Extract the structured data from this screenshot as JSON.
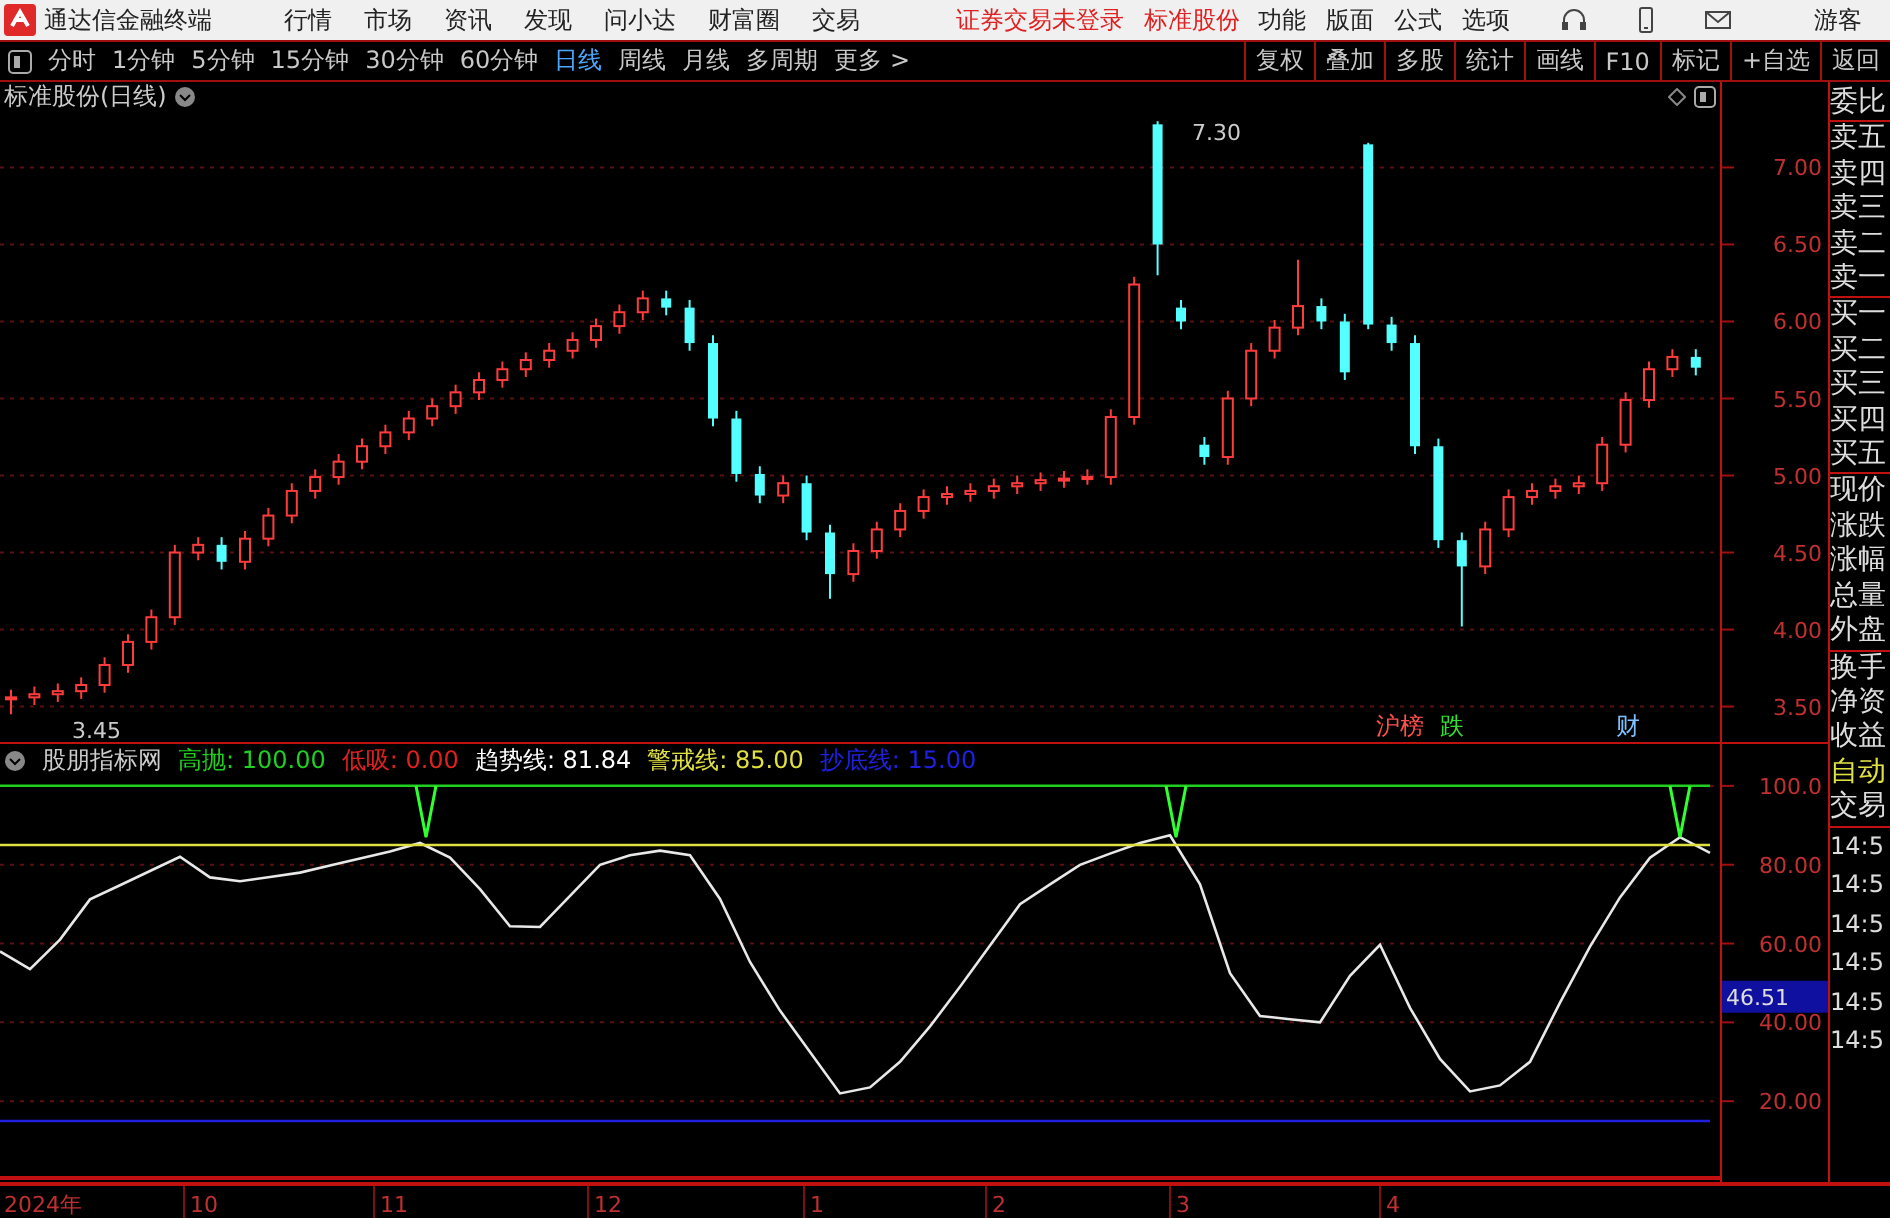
{
  "app": {
    "title": "通达信金融终端",
    "menus": [
      "行情",
      "市场",
      "资讯",
      "发现",
      "问小达",
      "财富圈",
      "交易"
    ],
    "status": [
      "证券交易未登录",
      "标准股份"
    ],
    "tools": [
      "功能",
      "版面",
      "公式",
      "选项"
    ],
    "user": "游客"
  },
  "toolbar": {
    "periods": [
      {
        "label": "分时",
        "selected": false
      },
      {
        "label": "1分钟",
        "selected": false
      },
      {
        "label": "5分钟",
        "selected": false
      },
      {
        "label": "15分钟",
        "selected": false
      },
      {
        "label": "30分钟",
        "selected": false
      },
      {
        "label": "60分钟",
        "selected": false
      },
      {
        "label": "日线",
        "selected": true
      },
      {
        "label": "周线",
        "selected": false
      },
      {
        "label": "月线",
        "selected": false
      },
      {
        "label": "多周期",
        "selected": false
      },
      {
        "label": "更多 >",
        "selected": false
      }
    ],
    "actions": [
      "复权",
      "叠加",
      "多股",
      "统计",
      "画线",
      "F10",
      "标记",
      "+自选",
      "返回"
    ]
  },
  "chart": {
    "title": "标准股份(日线)",
    "high_label": "7.30",
    "low_label": "3.45",
    "events": [
      {
        "label": "沪榜",
        "color": "#ff5050"
      },
      {
        "label": "跌",
        "color": "#30e030"
      },
      {
        "label": "财",
        "color": "#80c0ff"
      }
    ],
    "chart_data": {
      "type": "candlestick",
      "grid": true,
      "ylim": [
        3.27,
        7.36
      ],
      "yticks": [
        {
          "value": 7,
          "label": "7.00"
        },
        {
          "value": 6.5,
          "label": "6.50"
        },
        {
          "value": 6,
          "label": "6.00"
        },
        {
          "value": 5.5,
          "label": "5.50"
        },
        {
          "value": 5,
          "label": "5.00"
        },
        {
          "value": 4.5,
          "label": "4.50"
        },
        {
          "value": 4,
          "label": "4.00"
        },
        {
          "value": 3.5,
          "label": "3.50"
        }
      ],
      "ohlc": [
        [
          3.55,
          3.61,
          3.45,
          3.56
        ],
        [
          3.56,
          3.63,
          3.51,
          3.58
        ],
        [
          3.58,
          3.65,
          3.53,
          3.6
        ],
        [
          3.6,
          3.69,
          3.55,
          3.64
        ],
        [
          3.64,
          3.82,
          3.59,
          3.77
        ],
        [
          3.77,
          3.97,
          3.72,
          3.92
        ],
        [
          3.92,
          4.13,
          3.87,
          4.08
        ],
        [
          4.08,
          4.55,
          4.03,
          4.5
        ],
        [
          4.5,
          4.6,
          4.45,
          4.55
        ],
        [
          4.55,
          4.6,
          4.39,
          4.44
        ],
        [
          4.44,
          4.64,
          4.39,
          4.59
        ],
        [
          4.59,
          4.79,
          4.54,
          4.74
        ],
        [
          4.74,
          4.95,
          4.69,
          4.9
        ],
        [
          4.9,
          5.04,
          4.85,
          4.99
        ],
        [
          4.99,
          5.14,
          4.94,
          5.09
        ],
        [
          5.09,
          5.24,
          5.04,
          5.19
        ],
        [
          5.19,
          5.33,
          5.14,
          5.28
        ],
        [
          5.28,
          5.42,
          5.23,
          5.37
        ],
        [
          5.37,
          5.5,
          5.32,
          5.45
        ],
        [
          5.45,
          5.59,
          5.4,
          5.54
        ],
        [
          5.54,
          5.67,
          5.49,
          5.62
        ],
        [
          5.62,
          5.74,
          5.57,
          5.69
        ],
        [
          5.69,
          5.8,
          5.64,
          5.75
        ],
        [
          5.75,
          5.86,
          5.7,
          5.81
        ],
        [
          5.81,
          5.93,
          5.76,
          5.88
        ],
        [
          5.88,
          6.02,
          5.83,
          5.97
        ],
        [
          5.97,
          6.11,
          5.92,
          6.06
        ],
        [
          6.06,
          6.2,
          6.01,
          6.15
        ],
        [
          6.15,
          6.2,
          6.04,
          6.09
        ],
        [
          6.09,
          6.14,
          5.81,
          5.86
        ],
        [
          5.86,
          5.91,
          5.32,
          5.37
        ],
        [
          5.37,
          5.42,
          4.96,
          5.01
        ],
        [
          5.01,
          5.06,
          4.82,
          4.87
        ],
        [
          4.87,
          5.0,
          4.82,
          4.95
        ],
        [
          4.95,
          5.0,
          4.58,
          4.63
        ],
        [
          4.63,
          4.68,
          4.2,
          4.36
        ],
        [
          4.36,
          4.56,
          4.31,
          4.51
        ],
        [
          4.51,
          4.7,
          4.46,
          4.65
        ],
        [
          4.65,
          4.82,
          4.6,
          4.77
        ],
        [
          4.77,
          4.91,
          4.72,
          4.86
        ],
        [
          4.86,
          4.93,
          4.81,
          4.88
        ],
        [
          4.88,
          4.95,
          4.83,
          4.9
        ],
        [
          4.9,
          4.98,
          4.85,
          4.93
        ],
        [
          4.93,
          5.0,
          4.88,
          4.95
        ],
        [
          4.95,
          5.02,
          4.9,
          4.97
        ],
        [
          4.97,
          5.03,
          4.92,
          4.98
        ],
        [
          4.98,
          5.04,
          4.94,
          4.99
        ],
        [
          4.99,
          5.43,
          4.94,
          5.38
        ],
        [
          5.38,
          6.29,
          5.33,
          6.24
        ],
        [
          7.28,
          7.3,
          6.3,
          6.5
        ],
        [
          6.09,
          6.14,
          5.95,
          6.0
        ],
        [
          5.2,
          5.25,
          5.07,
          5.12
        ],
        [
          5.12,
          5.55,
          5.07,
          5.5
        ],
        [
          5.5,
          5.86,
          5.45,
          5.81
        ],
        [
          5.81,
          6.01,
          5.76,
          5.96
        ],
        [
          5.96,
          6.4,
          5.91,
          6.1
        ],
        [
          6.1,
          6.15,
          5.95,
          6.0
        ],
        [
          6.0,
          6.05,
          5.62,
          5.67
        ],
        [
          7.15,
          7.16,
          5.95,
          5.98
        ],
        [
          5.98,
          6.03,
          5.81,
          5.86
        ],
        [
          5.86,
          5.91,
          5.14,
          5.19
        ],
        [
          5.19,
          5.24,
          4.53,
          4.58
        ],
        [
          4.58,
          4.63,
          4.02,
          4.41
        ],
        [
          4.41,
          4.7,
          4.36,
          4.65
        ],
        [
          4.65,
          4.91,
          4.6,
          4.86
        ],
        [
          4.86,
          4.95,
          4.81,
          4.9
        ],
        [
          4.9,
          4.98,
          4.85,
          4.93
        ],
        [
          4.93,
          5.0,
          4.88,
          4.95
        ],
        [
          4.95,
          5.25,
          4.9,
          5.2
        ],
        [
          5.2,
          5.54,
          5.15,
          5.49
        ],
        [
          5.49,
          5.74,
          5.44,
          5.69
        ],
        [
          5.69,
          5.82,
          5.64,
          5.77
        ],
        [
          5.77,
          5.82,
          5.65,
          5.7
        ]
      ]
    }
  },
  "indicator": {
    "name": "股朋指标网",
    "lines": [
      {
        "kind": "level",
        "label": "高抛: 100.00",
        "color": "#20d020"
      },
      {
        "kind": "level",
        "label": "低吸: 0.00",
        "color": "#e02020"
      },
      {
        "kind": "level",
        "label": "趋势线: 81.84",
        "color": "#ffffff"
      },
      {
        "kind": "level",
        "label": "警戒线: 85.00",
        "color": "#e0e040"
      },
      {
        "kind": "level",
        "label": "抄底线: 15.00",
        "color": "#2020e0"
      }
    ],
    "current": "46.51",
    "chart_data": {
      "type": "line",
      "grid": true,
      "ylim": [
        -0.5,
        102
      ],
      "yticks": [
        {
          "value": 100,
          "label": "100.0"
        },
        {
          "value": 80,
          "label": "80.00"
        },
        {
          "value": 60,
          "label": "60.00"
        },
        {
          "value": 40,
          "label": "40.00"
        },
        {
          "value": 20,
          "label": "20.00"
        }
      ],
      "series": [
        {
          "color": "#e8e8e8",
          "values": [
            58,
            53.5,
            61,
            71.2,
            74.8,
            78.4,
            82,
            76.8,
            75.8,
            76.9,
            78,
            79.8,
            81.6,
            83.4,
            85.5,
            81.8,
            73.8,
            64.4,
            64.2,
            72.1,
            80,
            82.4,
            83.6,
            82.4,
            71.3,
            55.3,
            43,
            32.5,
            22,
            23.5,
            30,
            39,
            49,
            59.5,
            70,
            75,
            80,
            82.8,
            85.5,
            87.5,
            75,
            52.5,
            41.6,
            40.8,
            40,
            51.8,
            59.7,
            43.7,
            30.7,
            22.5,
            24,
            30,
            45,
            59.2,
            71.7,
            81.8,
            87,
            83
          ]
        },
        {
          "color": "#20d020",
          "values": [
            100,
            100,
            100,
            100,
            100,
            100,
            100,
            100,
            100,
            100,
            100,
            100,
            100,
            100,
            100,
            100,
            100,
            100,
            100,
            100,
            100,
            100,
            100,
            100,
            100,
            100,
            100,
            100,
            100,
            100,
            100,
            100,
            100,
            100,
            100,
            100,
            100,
            100,
            100,
            100,
            100,
            100,
            100,
            100,
            100,
            100,
            100,
            100,
            100,
            100,
            100,
            100,
            100,
            100,
            100,
            100,
            100,
            100
          ]
        },
        {
          "color": "#e0e040",
          "values": [
            85,
            85,
            85,
            85,
            85,
            85,
            85,
            85,
            85,
            85,
            85,
            85,
            85,
            85,
            85,
            85,
            85,
            85,
            85,
            85,
            85,
            85,
            85,
            85,
            85,
            85,
            85,
            85,
            85,
            85,
            85,
            85,
            85,
            85,
            85,
            85,
            85,
            85,
            85,
            85,
            85,
            85,
            85,
            85,
            85,
            85,
            85,
            85,
            85,
            85,
            85,
            85,
            85,
            85,
            85,
            85,
            85,
            85
          ]
        },
        {
          "color": "#2020e0",
          "values": [
            15,
            15,
            15,
            15,
            15,
            15,
            15,
            15,
            15,
            15,
            15,
            15,
            15,
            15,
            15,
            15,
            15,
            15,
            15,
            15,
            15,
            15,
            15,
            15,
            15,
            15,
            15,
            15,
            15,
            15,
            15,
            15,
            15,
            15,
            15,
            15,
            15,
            15,
            15,
            15,
            15,
            15,
            15,
            15,
            15,
            15,
            15,
            15,
            15,
            15,
            15,
            15,
            15,
            15,
            15,
            15,
            15,
            15
          ]
        }
      ]
    }
  },
  "quote_panel": {
    "groups": [
      [
        "委比"
      ],
      [
        "卖五",
        "卖四",
        "卖三",
        "卖二",
        "卖一"
      ],
      [
        "买一",
        "买二",
        "买三",
        "买四",
        "买五"
      ],
      [
        "现价",
        "涨跌",
        "涨幅",
        "总量",
        "外盘"
      ],
      [
        "换手",
        "净资",
        "收益"
      ]
    ],
    "mode": "自动",
    "trade": "交易",
    "times": [
      "14:5",
      "14:5",
      "14:5",
      "14:5",
      "14:5",
      "14:5"
    ]
  },
  "time_axis": [
    "2024年",
    "10",
    "11",
    "12",
    "1",
    "2",
    "3",
    "4"
  ]
}
